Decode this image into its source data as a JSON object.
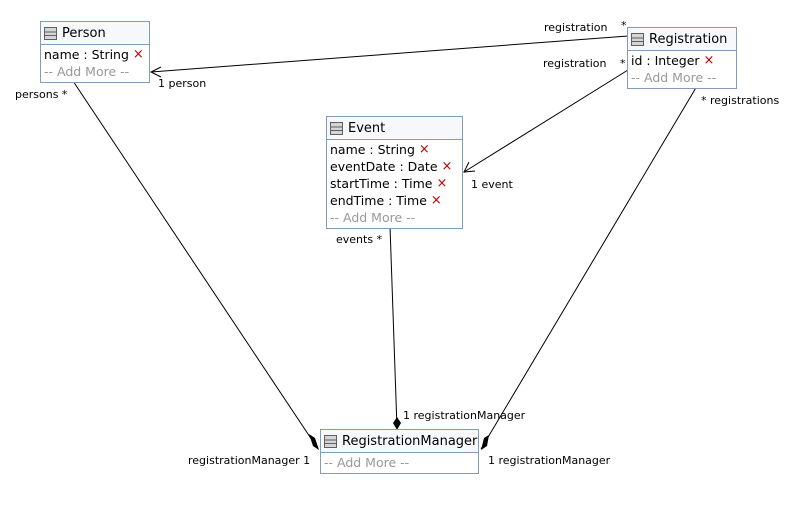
{
  "classes": {
    "person": {
      "name": "Person",
      "attributes": [
        {
          "label": "name : String"
        }
      ],
      "add_more": "-- Add More --"
    },
    "registration": {
      "name": "Registration",
      "attributes": [
        {
          "label": "id : Integer"
        }
      ],
      "add_more": "-- Add More --"
    },
    "event": {
      "name": "Event",
      "attributes": [
        {
          "label": "name : String"
        },
        {
          "label": "eventDate : Date"
        },
        {
          "label": "startTime : Time"
        },
        {
          "label": "endTime : Time"
        }
      ],
      "add_more": "-- Add More --"
    },
    "registration_manager": {
      "name": "RegistrationManager",
      "attributes": [],
      "add_more": "-- Add More --"
    }
  },
  "delete_glyph": "×",
  "associations": [
    {
      "from": "Registration",
      "to": "Person",
      "from_label": "registration",
      "from_mult": "*",
      "to_label": "1 person",
      "navigable": "to"
    },
    {
      "from": "Registration",
      "to": "Event",
      "from_label": "registration",
      "from_mult": "*",
      "to_label": "1 event",
      "navigable": "to"
    },
    {
      "from": "Person",
      "to": "RegistrationManager",
      "from_label": "persons *",
      "to_label": "registrationManager 1",
      "composition": true
    },
    {
      "from": "Event",
      "to": "RegistrationManager",
      "from_label": "events *",
      "to_label": "1 registrationManager",
      "composition": true
    },
    {
      "from": "Registration",
      "to": "RegistrationManager",
      "from_label": "* registrations",
      "to_label": "1 registrationManager",
      "composition": true
    }
  ],
  "labels": {
    "reg_person_role": "registration",
    "reg_person_mult": "*",
    "person_end": "1 person",
    "reg_event_role": "registration",
    "reg_event_mult": "*",
    "event_end": "1 event",
    "persons": "persons *",
    "events": "events *",
    "registrations": "* registrations",
    "rm_left": "registrationManager 1",
    "rm_top": "1 registrationManager",
    "rm_right": "1 registrationManager"
  }
}
